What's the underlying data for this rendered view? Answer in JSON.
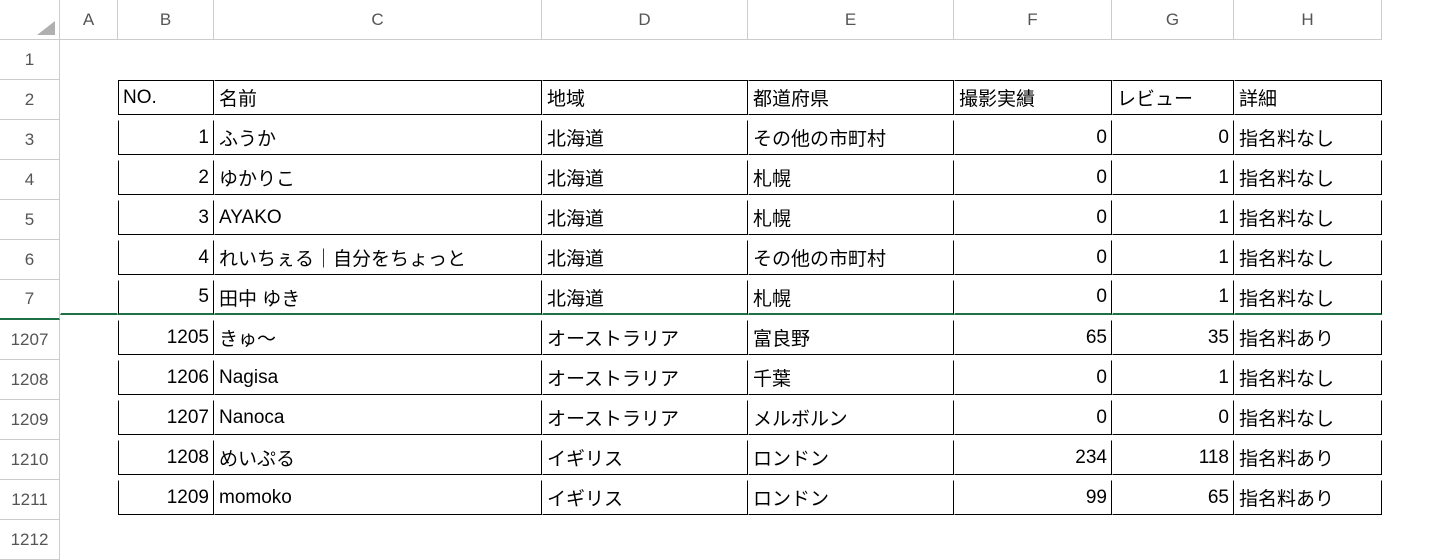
{
  "columns": [
    "A",
    "B",
    "C",
    "D",
    "E",
    "F",
    "G",
    "H"
  ],
  "row_numbers": [
    "1",
    "2",
    "3",
    "4",
    "5",
    "6",
    "7",
    "1207",
    "1208",
    "1209",
    "1210",
    "1211",
    "1212"
  ],
  "headers": {
    "b": "NO.",
    "c": "名前",
    "d": "地域",
    "e": "都道府県",
    "f": "撮影実績",
    "g": "レビュー",
    "h": "詳細"
  },
  "rows": [
    {
      "no": "1",
      "name": "ふうか",
      "region": "北海道",
      "pref": "その他の市町村",
      "shoot": "0",
      "review": "0",
      "detail": "指名料なし"
    },
    {
      "no": "2",
      "name": "ゆかりこ",
      "region": "北海道",
      "pref": "札幌",
      "shoot": "0",
      "review": "1",
      "detail": "指名料なし"
    },
    {
      "no": "3",
      "name": "AYAKO",
      "region": "北海道",
      "pref": "札幌",
      "shoot": "0",
      "review": "1",
      "detail": "指名料なし"
    },
    {
      "no": "4",
      "name": "れいちぇる｜自分をちょっと",
      "region": "北海道",
      "pref": "その他の市町村",
      "shoot": "0",
      "review": "1",
      "detail": "指名料なし"
    },
    {
      "no": "5",
      "name": "田中 ゆき",
      "region": "北海道",
      "pref": "札幌",
      "shoot": "0",
      "review": "1",
      "detail": "指名料なし"
    },
    {
      "no": "1205",
      "name": "きゅ～",
      "region": "オーストラリア",
      "pref": "富良野",
      "shoot": "65",
      "review": "35",
      "detail": "指名料あり"
    },
    {
      "no": "1206",
      "name": "Nagisa",
      "region": "オーストラリア",
      "pref": "千葉",
      "shoot": "0",
      "review": "1",
      "detail": "指名料なし"
    },
    {
      "no": "1207",
      "name": "Nanoca",
      "region": "オーストラリア",
      "pref": "メルボルン",
      "shoot": "0",
      "review": "0",
      "detail": "指名料なし"
    },
    {
      "no": "1208",
      "name": "めいぷる",
      "region": "イギリス",
      "pref": "ロンドン",
      "shoot": "234",
      "review": "118",
      "detail": "指名料あり"
    },
    {
      "no": "1209",
      "name": "momoko",
      "region": "イギリス",
      "pref": "ロンドン",
      "shoot": "99",
      "review": "65",
      "detail": "指名料あり"
    }
  ]
}
